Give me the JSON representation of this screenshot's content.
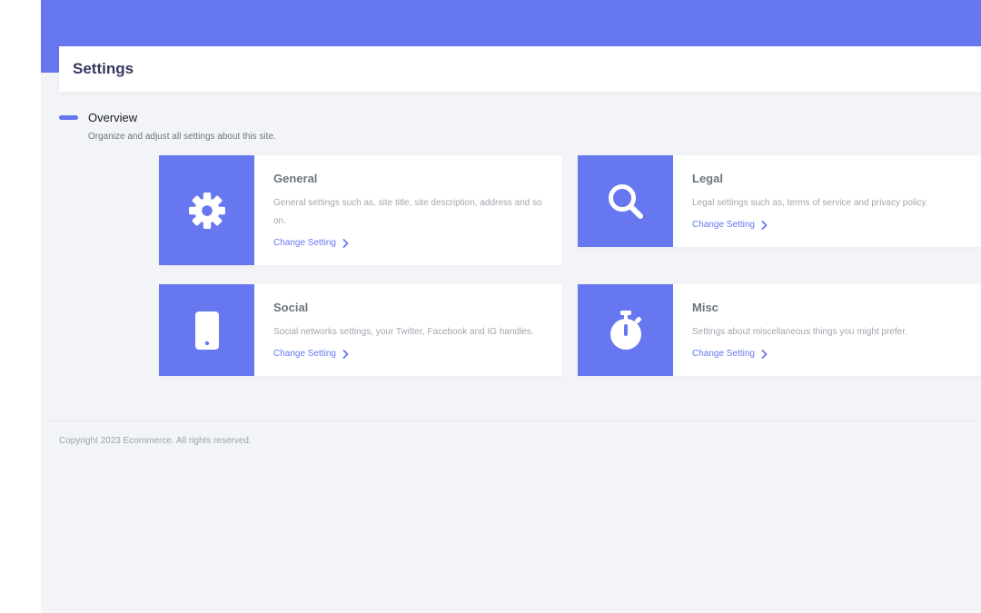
{
  "header": {
    "title": "Settings"
  },
  "overview": {
    "title": "Overview",
    "description": "Organize and adjust all settings about this site."
  },
  "cards": [
    {
      "title": "General",
      "description": "General settings such as, site title, site description, address and so on.",
      "link_label": "Change Setting",
      "icon": "gear-icon"
    },
    {
      "title": "Legal",
      "description": "Legal settings such as, terms of service and privacy policy.",
      "link_label": "Change Setting",
      "icon": "search-icon"
    },
    {
      "title": "Social",
      "description": "Social networks settings, your Twitter, Facebook and IG handles.",
      "link_label": "Change Setting",
      "icon": "mobile-phone-icon"
    },
    {
      "title": "Misc",
      "description": "Settings about miscellaneous things you might prefer.",
      "link_label": "Change Setting",
      "icon": "stopwatch-icon"
    }
  ],
  "footer": {
    "copyright": "Copyright 2023 Ecommerce. All rights reserved."
  },
  "colors": {
    "primary": "#6777ef",
    "background": "#f3f4f8",
    "title_text": "#34395e"
  }
}
